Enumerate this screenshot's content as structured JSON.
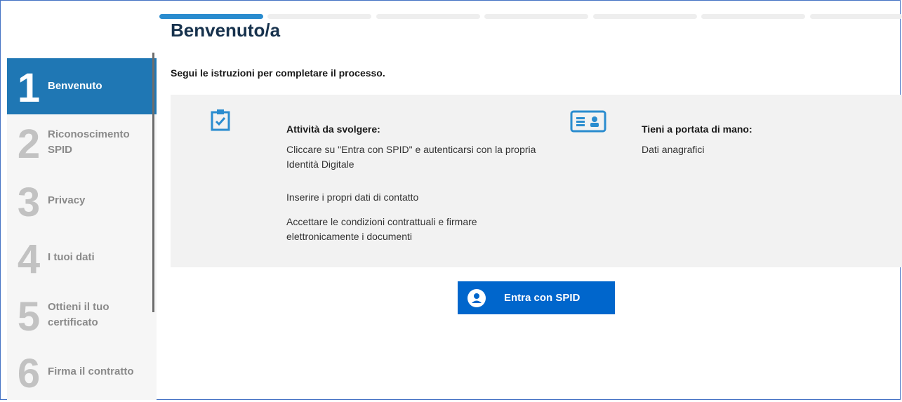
{
  "header": {
    "title": "Benvenuto/a"
  },
  "progress": {
    "current_step": 1,
    "total_steps": 7
  },
  "sidebar": {
    "steps": [
      {
        "number": "1",
        "label": "Benvenuto"
      },
      {
        "number": "2",
        "label": "Riconoscimento SPID"
      },
      {
        "number": "3",
        "label": "Privacy"
      },
      {
        "number": "4",
        "label": "I tuoi dati"
      },
      {
        "number": "5",
        "label": "Ottieni il tuo certificato"
      },
      {
        "number": "6",
        "label": "Firma il contratto"
      }
    ]
  },
  "main": {
    "intro": "Segui le istruzioni per completare il processo.",
    "activities": {
      "icon": "clipboard-check-icon",
      "title": "Attività da svolgere:",
      "items": [
        "Cliccare su \"Entra con SPID\" e autenticarsi con la propria Identità Digitale",
        "Inserire i propri dati di contatto",
        "Accettare le condizioni contrattuali e firmare elettronicamente i documenti"
      ]
    },
    "keep_handy": {
      "icon": "id-card-icon",
      "title": "Tieni a portata di mano:",
      "items": [
        "Dati anagrafici"
      ]
    },
    "spid_button": {
      "label": "Entra con SPID",
      "icon": "user-circle-icon"
    }
  },
  "colors": {
    "accent": "#1f77b4",
    "progress": "#2a8ccf",
    "button": "#0066cc",
    "title": "#17324d"
  }
}
